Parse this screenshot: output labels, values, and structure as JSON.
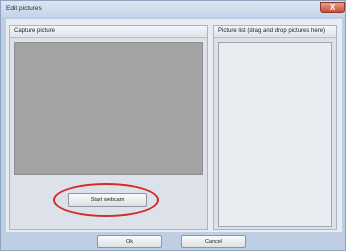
{
  "window": {
    "title": "Edit pictures",
    "close_glyph": "X"
  },
  "capture": {
    "label": "Capture picture",
    "start_button_label": "Start webcam"
  },
  "picture_list": {
    "label": "Picture list (drag and drop pictures here)"
  },
  "footer": {
    "ok_label": "Ok",
    "cancel_label": "Cancel"
  },
  "colors": {
    "highlight": "#d32a2a",
    "preview": "#a3a3a3",
    "close_button": "#c8503a"
  }
}
